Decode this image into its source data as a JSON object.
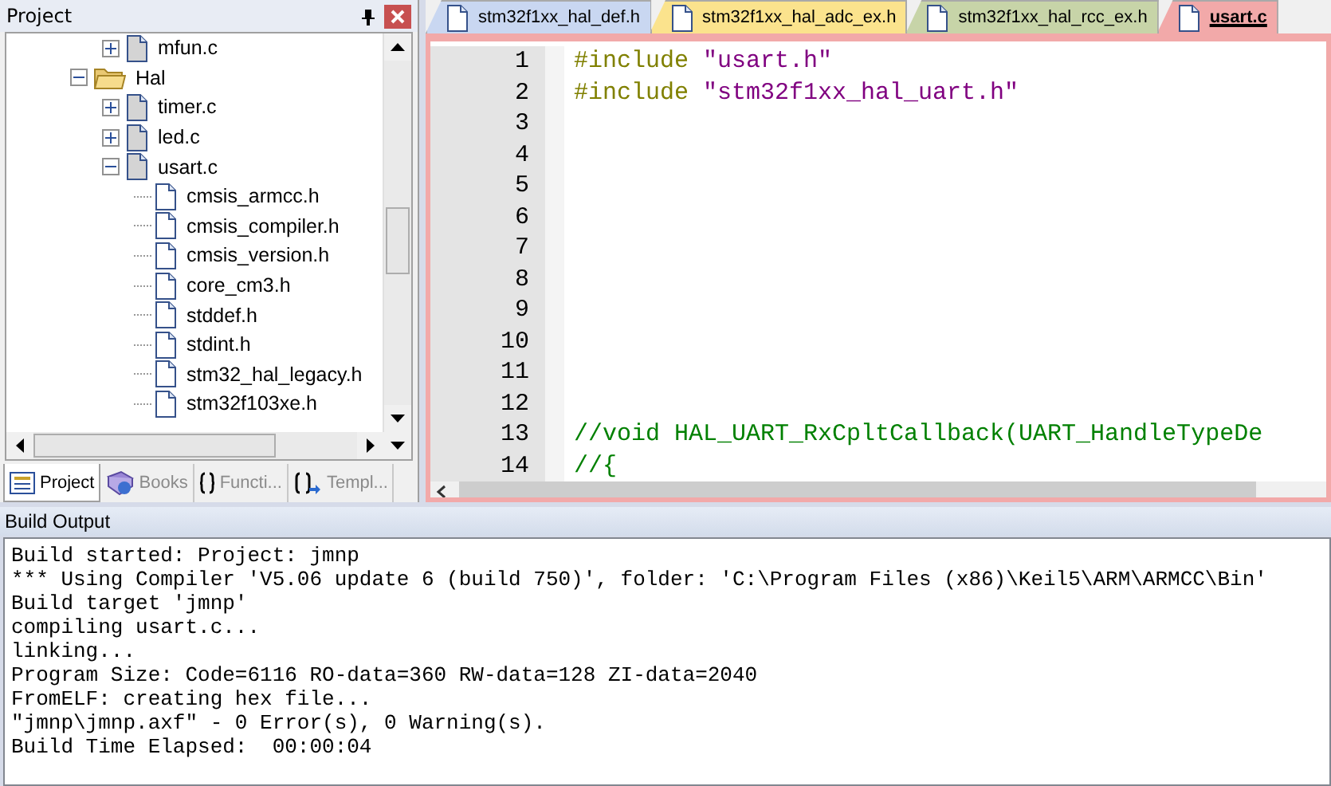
{
  "project_panel": {
    "title": "Project",
    "tree": [
      {
        "children": [
          {
            "label": "mfun.c",
            "kind": "file",
            "expanded": false
          }
        ]
      },
      {
        "label": "Hal",
        "kind": "folder",
        "expanded": true,
        "children": [
          {
            "label": "timer.c",
            "kind": "file",
            "expanded": false
          },
          {
            "label": "led.c",
            "kind": "file",
            "expanded": false
          },
          {
            "label": "usart.c",
            "kind": "file",
            "expanded": true,
            "children": [
              {
                "label": "cmsis_armcc.h",
                "kind": "header"
              },
              {
                "label": "cmsis_compiler.h",
                "kind": "header"
              },
              {
                "label": "cmsis_version.h",
                "kind": "header"
              },
              {
                "label": "core_cm3.h",
                "kind": "header"
              },
              {
                "label": "stddef.h",
                "kind": "header"
              },
              {
                "label": "stdint.h",
                "kind": "header"
              },
              {
                "label": "stm32_hal_legacy.h",
                "kind": "header"
              },
              {
                "label": "stm32f103xe.h",
                "kind": "header"
              }
            ]
          }
        ]
      }
    ],
    "tabs": [
      {
        "label": "Project",
        "kind": "project",
        "selected": true
      },
      {
        "label": "Books",
        "kind": "books",
        "selected": false
      },
      {
        "label": "Functi...",
        "kind": "functions",
        "selected": false
      },
      {
        "label": "Templ...",
        "kind": "templates",
        "selected": false
      }
    ]
  },
  "editor": {
    "tabs": [
      {
        "label": "stm32f1xx_hal_def.h",
        "color": "#c9d7f1",
        "selected": false
      },
      {
        "label": "stm32f1xx_hal_adc_ex.h",
        "color": "#fbe38d",
        "selected": false
      },
      {
        "label": "stm32f1xx_hal_rcc_ex.h",
        "color": "#c7d4a8",
        "selected": false
      },
      {
        "label": "usart.c",
        "color": "#f2a9a9",
        "selected": true
      }
    ],
    "lines": [
      {
        "number": "1",
        "segments": [
          {
            "kind": "directive",
            "text": "#include"
          },
          {
            "kind": "string",
            "text": " \"usart.h\""
          }
        ]
      },
      {
        "number": "2",
        "segments": [
          {
            "kind": "directive",
            "text": "#include"
          },
          {
            "kind": "string",
            "text": " \"stm32f1xx_hal_uart.h\""
          }
        ]
      },
      {
        "number": "3"
      },
      {
        "number": "4"
      },
      {
        "number": "5"
      },
      {
        "number": "6"
      },
      {
        "number": "7"
      },
      {
        "number": "8"
      },
      {
        "number": "9"
      },
      {
        "number": "10"
      },
      {
        "number": "11"
      },
      {
        "number": "12"
      },
      {
        "number": "13",
        "segments": [
          {
            "kind": "comment",
            "text": "//void HAL_UART_RxCpltCallback(UART_HandleTypeDe"
          }
        ]
      },
      {
        "number": "14",
        "segments": [
          {
            "kind": "comment",
            "text": "//{"
          }
        ]
      }
    ]
  },
  "build_output": {
    "title": "Build Output",
    "lines": [
      "Build started: Project: jmnp",
      "*** Using Compiler 'V5.06 update 6 (build 750)', folder: 'C:\\Program Files (x86)\\Keil5\\ARM\\ARMCC\\Bin'",
      "Build target 'jmnp'",
      "compiling usart.c...",
      "linking...",
      "Program Size: Code=6116 RO-data=360 RW-data=128 ZI-data=2040",
      "FromELF: creating hex file...",
      "\"jmnp\\jmnp.axf\" - 0 Error(s), 0 Warning(s).",
      "Build Time Elapsed:  00:00:04"
    ]
  }
}
